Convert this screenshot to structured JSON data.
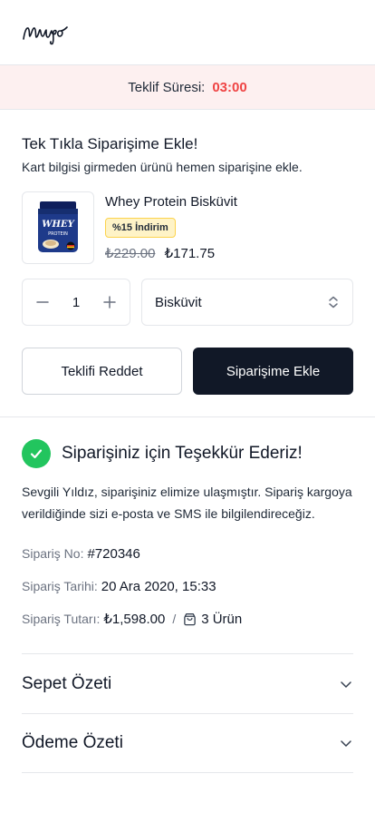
{
  "app": {
    "logo_text": "Mugo"
  },
  "timer": {
    "label": "Teklif Süresi:",
    "value": "03:00",
    "color": "#ef4444"
  },
  "offer": {
    "title": "Tek Tıkla Siparişime Ekle!",
    "subtitle": "Kart bilgisi girmeden ürünü hemen siparişine ekle.",
    "product": {
      "name": "Whey Protein Bisküvit",
      "image_icon": "protein-jar-icon",
      "badge": "%15 İndirim",
      "old_price": "₺229.00",
      "new_price": "₺171.75"
    },
    "quantity": {
      "value": "1",
      "minus_icon": "minus-icon",
      "plus_icon": "plus-icon"
    },
    "variant": {
      "selected": "Bisküvit",
      "icon": "chevron-up-down-icon"
    },
    "reject_label": "Teklifi Reddet",
    "accept_label": "Siparişime Ekle"
  },
  "confirmation": {
    "icon": "check-circle-icon",
    "title": "Siparişiniz için Teşekkür Ederiz!",
    "message": "Sevgili Yıldız,  siparişiniz elimize ulaşmıştır. Sipariş kargoya verildiğinde sizi e-posta ve SMS ile bilgilendireceğiz.",
    "order_no_label": "Sipariş No:",
    "order_no": "#720346",
    "order_date_label": "Sipariş Tarihi:",
    "order_date": "20 Ara 2020, 15:33",
    "order_total_label": "Sipariş Tutarı:",
    "order_total": "₺1,598.00",
    "separator": "/",
    "items_icon": "shopping-bag-icon",
    "items_count": "3 Ürün"
  },
  "accordion": [
    {
      "title": "Sepet Özeti",
      "icon": "chevron-down-icon"
    },
    {
      "title": "Ödeme Özeti",
      "icon": "chevron-down-icon"
    }
  ],
  "colors": {
    "accent_dark": "#111827",
    "success": "#22c55e",
    "timer_bg": "#fdf0f0",
    "badge_bg": "#fef3c7"
  }
}
